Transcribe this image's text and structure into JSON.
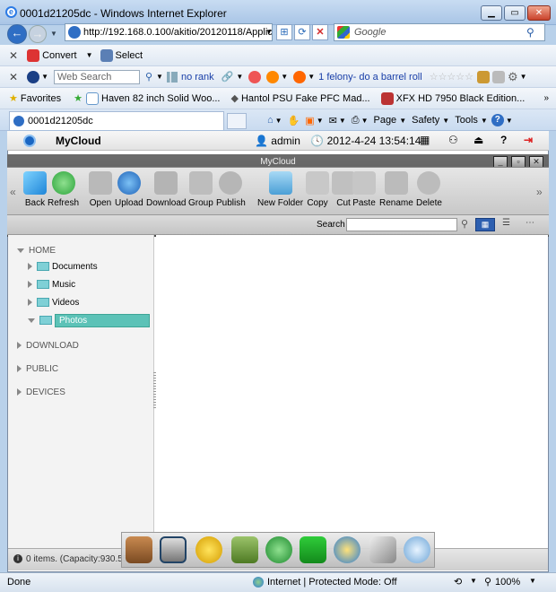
{
  "window": {
    "title": "0001d21205dc - Windows Internet Explorer"
  },
  "address": {
    "url": "http://192.168.0.100/akitio/20120118/Applicati",
    "search_placeholder": "Google"
  },
  "toolbar1": {
    "convert": "Convert",
    "select": "Select"
  },
  "toolbar2": {
    "web_search": "Web Search",
    "rank": "no rank",
    "news": "1 felony- do a barrel roll"
  },
  "favorites": {
    "label": "Favorites",
    "items": [
      "Haven 82 inch Solid Woo...",
      "Hantol PSU Fake PFC Mad...",
      "XFX HD 7950 Black Edition..."
    ]
  },
  "tab": {
    "label": "0001d21205dc"
  },
  "ie_commands": {
    "page": "Page",
    "safety": "Safety",
    "tools": "Tools"
  },
  "app": {
    "name": "MyCloud",
    "user": "admin",
    "datetime": "2012-4-24 13:54:14",
    "window_title": "MyCloud",
    "tools": [
      "Back",
      "Refresh",
      "Open",
      "Upload",
      "Download",
      "Group",
      "Publish",
      "New Folder",
      "Copy",
      "Cut",
      "Paste",
      "Rename",
      "Delete"
    ],
    "search_label": "Search",
    "tree": {
      "home": "HOME",
      "children": [
        "Documents",
        "Music",
        "Videos",
        "Photos"
      ],
      "download": "DOWNLOAD",
      "public": "PUBLIC",
      "devices": "DEVICES"
    },
    "status": "0 items. (Capacity:930.55"
  },
  "ie_status": {
    "done": "Done",
    "zone": "Internet | Protected Mode: Off",
    "zoom": "100%"
  },
  "colors": {
    "accent": "#5cc2b7",
    "toolbar_dark": "#4d4d4d"
  }
}
